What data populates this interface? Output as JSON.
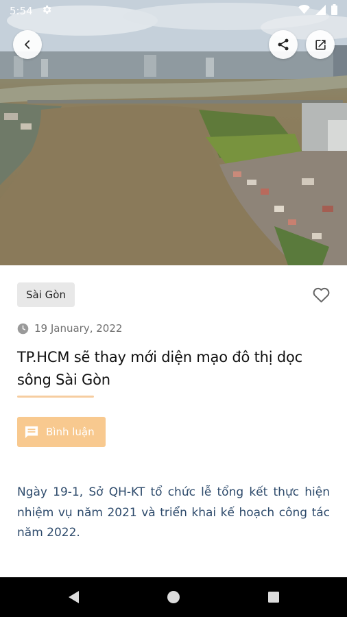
{
  "status_bar": {
    "time": "5:54",
    "icons": [
      "settings-icon",
      "wifi-icon",
      "signal-icon",
      "battery-icon"
    ]
  },
  "hero": {
    "description_icon": "river-photo"
  },
  "toolbar": {
    "back_icon": "arrow-left-icon",
    "share_icon": "share-icon",
    "open_icon": "open-external-icon"
  },
  "article": {
    "category": "Sài Gòn",
    "date": "19 January, 2022",
    "title": "TP.HCM sẽ thay mới diện mạo đô thị dọc sông Sài Gòn",
    "comment_label": "Bình luận",
    "summary": "Ngày 19-1, Sở QH-KT tổ chức lễ tổng kết thực hiện nhiệm vụ năm 2021 và triển khai kế hoạch công tác năm 2022."
  },
  "colors": {
    "accent": "#f8c98f",
    "summary_text": "#2d4a6b",
    "tag_bg": "#e8e8e8"
  },
  "nav_bar": {
    "icons": [
      "nav-back-icon",
      "nav-home-icon",
      "nav-recent-icon"
    ]
  }
}
